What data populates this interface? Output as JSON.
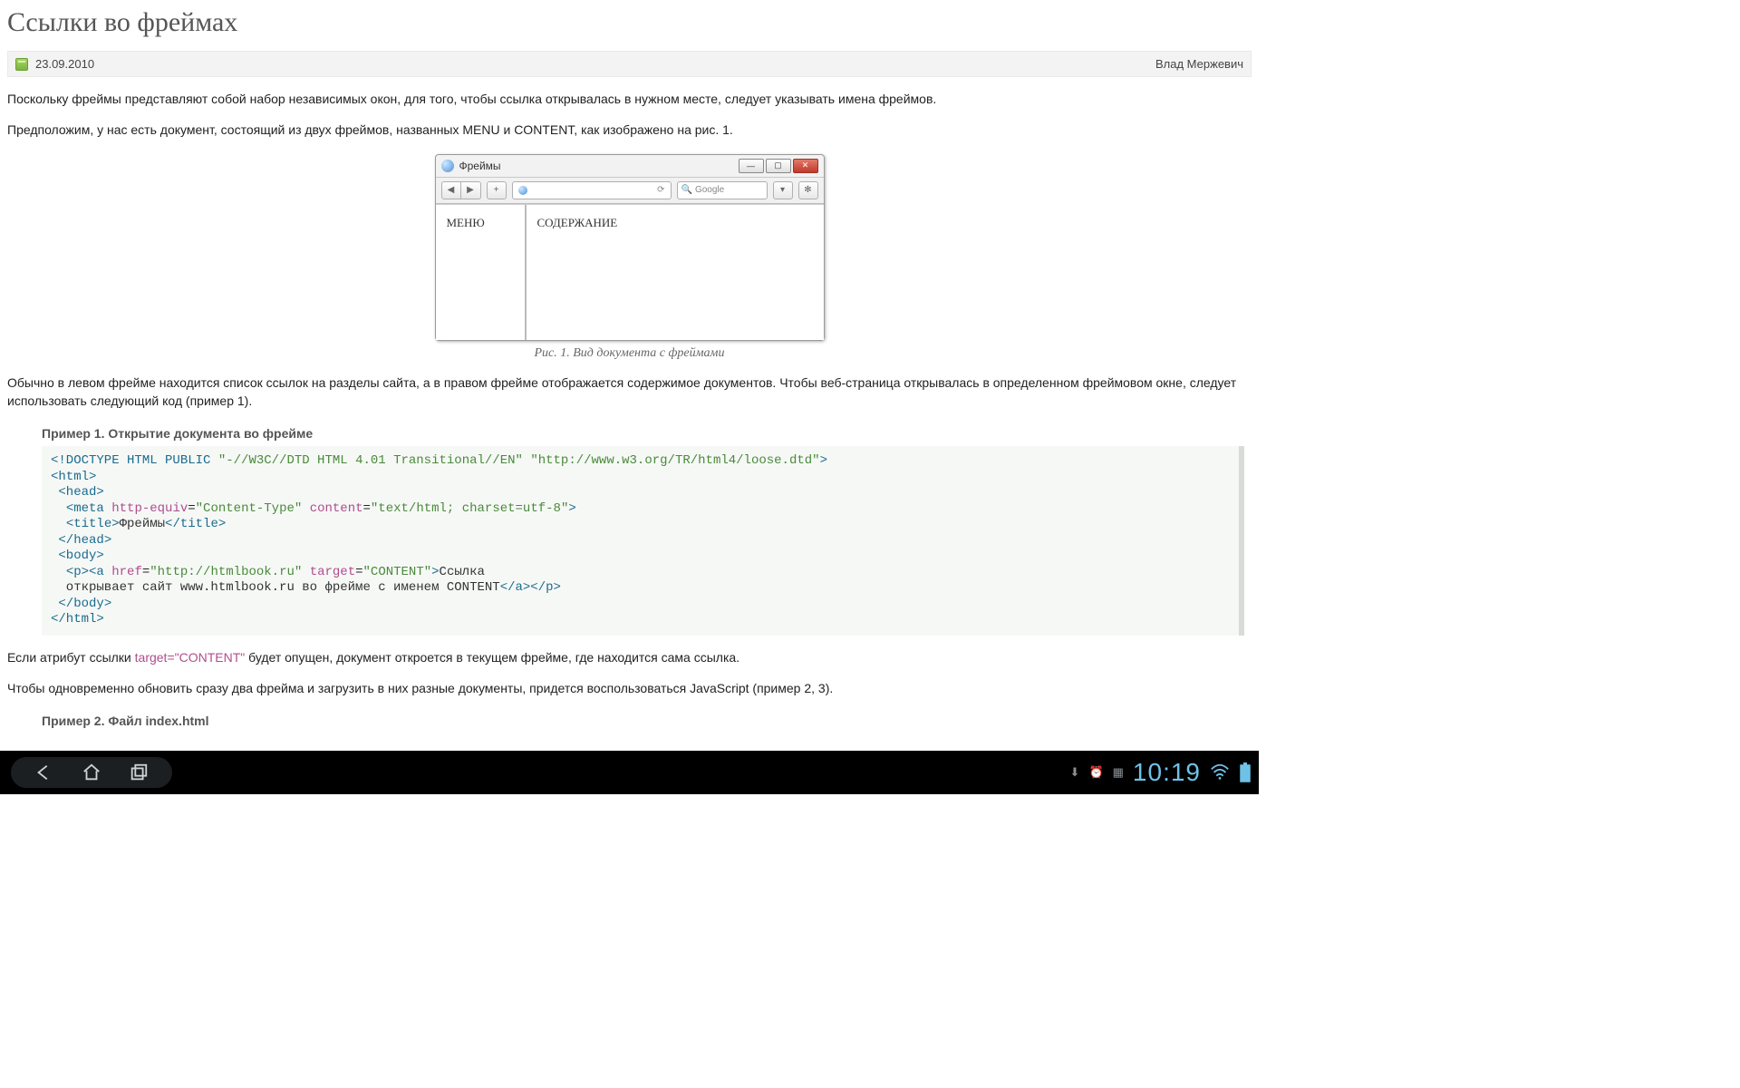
{
  "title": "Ссылки во фреймах",
  "meta": {
    "date": "23.09.2010",
    "author": "Влад Мержевич"
  },
  "intro": {
    "p1": "Поскольку фреймы представляют собой набор независимых окон, для того, чтобы ссылка открывалась в нужном месте, следует указывать имена фреймов.",
    "p2": "Предположим, у нас есть документ, состоящий из двух фреймов, названных MENU и CONTENT, как изображено на рис. 1."
  },
  "mock": {
    "winTitle": "Фреймы",
    "searchPlaceholder": "Google",
    "leftLabel": "МЕНЮ",
    "rightLabel": "СОДЕРЖАНИЕ"
  },
  "figcap": "Рис. 1. Вид документа с фреймами",
  "body1": "Обычно в левом фрейме находится список ссылок на разделы сайта, а в правом фрейме отображается содержимое документов. Чтобы веб-страница открывалась в определенном фреймовом окне, следует использовать следующий код (пример 1).",
  "ex1": {
    "title": "Пример 1. Открытие документа во фрейме"
  },
  "code1": {
    "doctype": "<!DOCTYPE HTML PUBLIC ",
    "doctypeStr1": "\"-//W3C//DTD HTML 4.01 Transitional//EN\"",
    "doctypeStr2": "\"http://www.w3.org/TR/html4/loose.dtd\"",
    "httpEquiv": "http-equiv",
    "httpEquivVal": "\"Content-Type\"",
    "contentAttr": "content",
    "contentVal": "\"text/html; charset=utf-8\"",
    "titleText": "Фреймы",
    "href": "href",
    "hrefVal": "\"http://htmlbook.ru\"",
    "target": "target",
    "targetVal": "\"CONTENT\"",
    "linkText": "Ссылка",
    "linkLine2": "  открывает сайт www.htmlbook.ru во фрейме с именем CONTENT"
  },
  "body2a": "Если атрибут ссылки ",
  "body2code": "target=\"CONTENT\"",
  "body2b": " будет опущен, документ откроется в текущем фрейме, где находится сама ссылка.",
  "body3": "Чтобы одновременно обновить сразу два фрейма и загрузить в них разные документы, придется воспользоваться JavaScript (пример 2, 3).",
  "ex2": {
    "title": "Пример 2. Файл index.html"
  },
  "android": {
    "time": "10:19"
  }
}
